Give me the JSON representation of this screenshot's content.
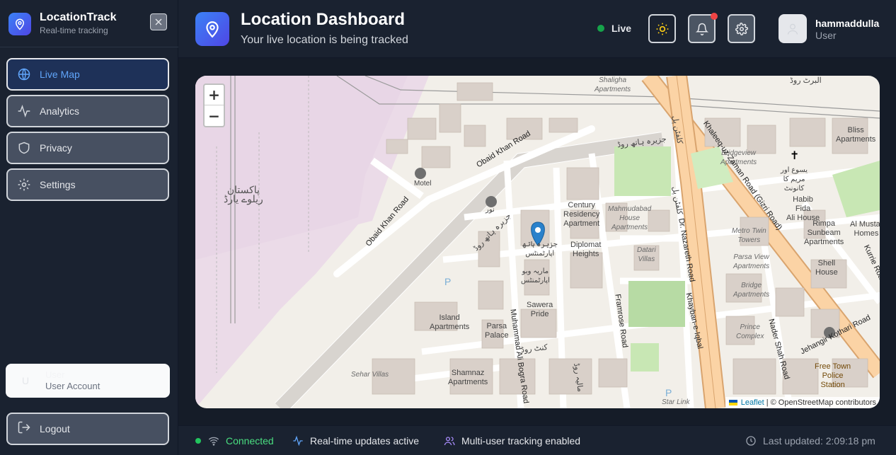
{
  "app": {
    "title": "LocationTrack",
    "subtitle": "Real-time tracking"
  },
  "sidebar": {
    "nav": [
      {
        "label": "Live Map",
        "icon": "globe-icon",
        "active": true
      },
      {
        "label": "Analytics",
        "icon": "activity-icon",
        "active": false
      },
      {
        "label": "Privacy",
        "icon": "shield-icon",
        "active": false
      },
      {
        "label": "Settings",
        "icon": "gear-icon",
        "active": false
      }
    ],
    "user_card": {
      "name": "User",
      "role": "User Account",
      "avatar": "U"
    },
    "logout_label": "Logout"
  },
  "header": {
    "title": "Location Dashboard",
    "subtitle": "Your live location is being tracked",
    "status_label": "Live",
    "user": {
      "name": "hammaddulla",
      "role": "User"
    }
  },
  "map": {
    "zoom_in": "+",
    "zoom_out": "−",
    "attribution": {
      "link": "Leaflet",
      "text": "| © OpenStreetMap contributors"
    },
    "labels": {
      "obaid_khan_road_1": "Obaid Khan Road",
      "obaid_khan_road_2": "Obaid Khan Road",
      "pakistan_railway_yard": "پاکستان\nریلوے یارڈ",
      "century": "Century\nResidency\nApartment",
      "diplomat": "Diplomat\nHeights",
      "mahmudabad": "Mahmudabad\nHouse\nApartments",
      "datari": "Datari\nVillas",
      "sawera": "Sawera\nPride",
      "island": "Island\nApartments",
      "parsa_palace": "Parsa\nPalace",
      "shamnaz": "Shamnaz\nApartments",
      "sehar": "Sehar Villas",
      "bliss": "Bliss\nApartments",
      "bridgeview": "Bridgeview\nApartments",
      "habib_fida": "Habib\nFida\nAli House",
      "rimpa": "Rimpa\nSunbeam\nApartments",
      "al_mustafa": "Al Mustaf\nHomes",
      "shell_house": "Shell\nHouse",
      "metro_twin": "Metro Twin\nTowers",
      "parsa_view": "Parsa View\nApartments",
      "bridge_apts": "Bridge\nApartments",
      "prince_complex": "Prince\nComplex",
      "free_town": "Free Town\nPolice\nStation",
      "star_link": "Star Link",
      "motel": "Motel",
      "shaligha": "Shaligha\nApartments",
      "khaleeq_road": "Khaleeq-uz-Zaman Road (Gizri Road)",
      "nazareth": "Dr. Nazareth Road",
      "khayban": "Khayban-e-Iqbal",
      "framrose": "Framrose Road",
      "muhammad_ali": "Muhammad Ali Bogra Road",
      "nader_shah": "Nader Shah Road",
      "jehangir": "Jehangir Kothari Road",
      "kurrie": "Kurrie Road",
      "urdu_1": "جزیرہ ہاتھ روڈ",
      "urdu_2": "جزیرہ ہاتھ روڈ",
      "urdu_3": "البرٹ روڈ",
      "urdu_4": "کلفٹن پل",
      "urdu_5": "کلفٹن پل",
      "urdu_6": "کنٹ روڈ",
      "urdu_7": "مالیہ روڈ",
      "urdu_8": "یسوع اور\nمریم کا\nکانونٹ",
      "urdu_9": "جزیرہ ہاتھ\nاپارٹمنٹس",
      "urdu_10": "ماریہ وبو\nاپارٹمنٹس",
      "urdu_11": "نور"
    }
  },
  "footer": {
    "connected": "Connected",
    "realtime": "Real-time updates active",
    "multiuser": "Multi-user tracking enabled",
    "last_updated": "Last updated: 2:09:18 pm"
  },
  "colors": {
    "accent": "#3b82f6",
    "live": "#16a34a",
    "connected": "#4ade80",
    "realtime_icon": "#60a5fa",
    "multiuser_icon": "#a78bfa",
    "notification": "#ef4444"
  }
}
